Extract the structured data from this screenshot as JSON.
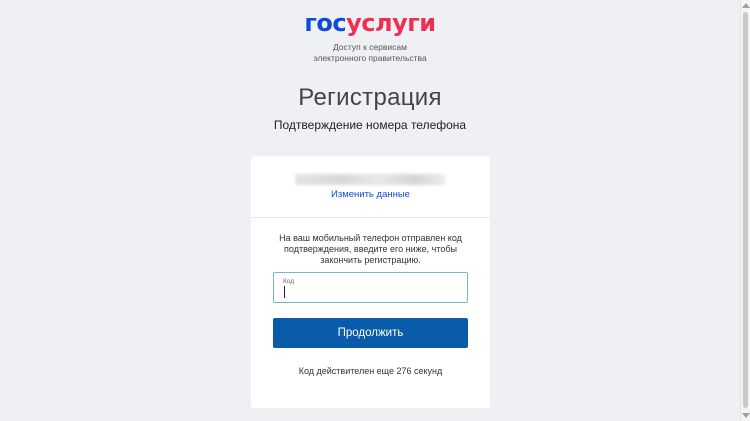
{
  "logo": {
    "part1": "гос",
    "part2": "услуги"
  },
  "tagline": {
    "line1": "Доступ к сервисам",
    "line2": "электронного правительства"
  },
  "title": "Регистрация",
  "subtitle": "Подтверждение номера телефона",
  "card": {
    "change_link": "Изменить данные",
    "info_text": "На ваш мобильный телефон отправлен код подтверждения, введите его ниже, чтобы закончить регистрацию.",
    "code_field": {
      "label": "Код",
      "value": ""
    },
    "continue_label": "Продолжить",
    "timer_text": "Код действителен еще 276 секунд"
  },
  "colors": {
    "brand_blue": "#0d4cd3",
    "brand_red": "#ee2f53",
    "button_blue": "#0a5ba9",
    "link_blue": "#0d4cd3"
  }
}
